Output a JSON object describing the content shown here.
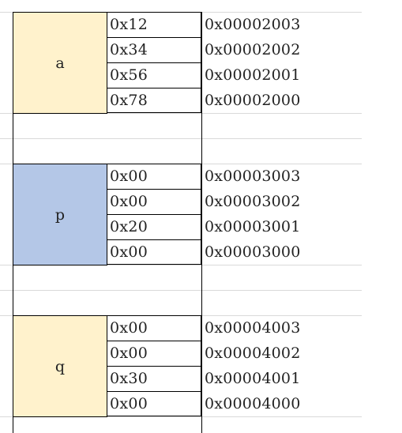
{
  "blocks": [
    {
      "var_name": "a",
      "rows": [
        {
          "value": "0x12",
          "address": "0x00002003"
        },
        {
          "value": "0x34",
          "address": "0x00002002"
        },
        {
          "value": "0x56",
          "address": "0x00002001"
        },
        {
          "value": "0x78",
          "address": "0x00002000"
        }
      ]
    },
    {
      "var_name": "p",
      "rows": [
        {
          "value": "0x00",
          "address": "0x00003003"
        },
        {
          "value": "0x00",
          "address": "0x00003002"
        },
        {
          "value": "0x20",
          "address": "0x00003001"
        },
        {
          "value": "0x00",
          "address": "0x00003000"
        }
      ]
    },
    {
      "var_name": "q",
      "rows": [
        {
          "value": "0x00",
          "address": "0x00004003"
        },
        {
          "value": "0x00",
          "address": "0x00004002"
        },
        {
          "value": "0x30",
          "address": "0x00004001"
        },
        {
          "value": "0x00",
          "address": "0x00004000"
        }
      ]
    }
  ],
  "colors": {
    "char_block": "#fff2cc",
    "pointer_block": "#b4c7e7",
    "gridline": "#d9d9d9"
  }
}
